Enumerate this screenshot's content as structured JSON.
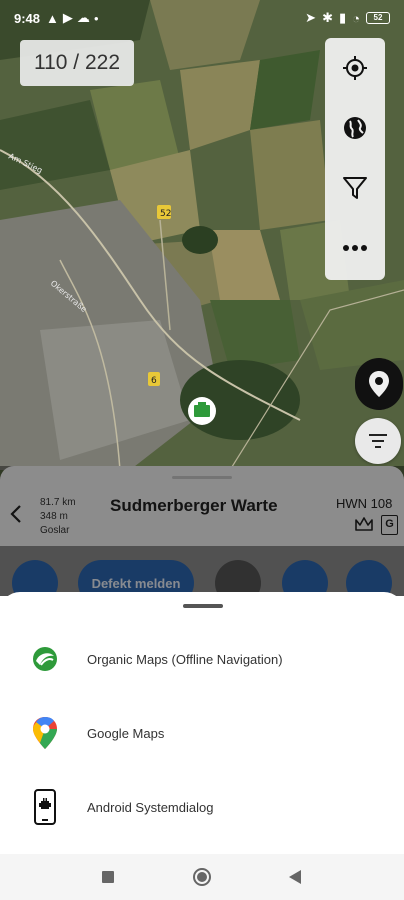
{
  "status_bar": {
    "time": "9:48",
    "battery": "52"
  },
  "map": {
    "counter": "110 / 222",
    "road_labels": [
      "Am Stieg",
      "Okerstraße"
    ],
    "road_badges": [
      "52",
      "6"
    ]
  },
  "toolbar": {
    "icons": [
      "locate-icon",
      "globe-icon",
      "filter-icon",
      "more-icon"
    ]
  },
  "info_panel": {
    "distance": "81.7 km",
    "elevation": "348 m",
    "location": "Goslar",
    "title": "Sudmerberger Warte",
    "code": "HWN 108",
    "badge": "G"
  },
  "actions": {
    "report_defect": "Defekt melden"
  },
  "share_sheet": {
    "options": [
      {
        "label": "Organic Maps (Offline Navigation)",
        "icon": "organic-maps-icon"
      },
      {
        "label": "Google Maps",
        "icon": "google-maps-icon"
      },
      {
        "label": "Android Systemdialog",
        "icon": "android-phone-icon"
      }
    ]
  },
  "colors": {
    "accent_blue": "#2c66b0",
    "map_green": "#4a5a3a",
    "marker_green": "#2e9a3a"
  }
}
